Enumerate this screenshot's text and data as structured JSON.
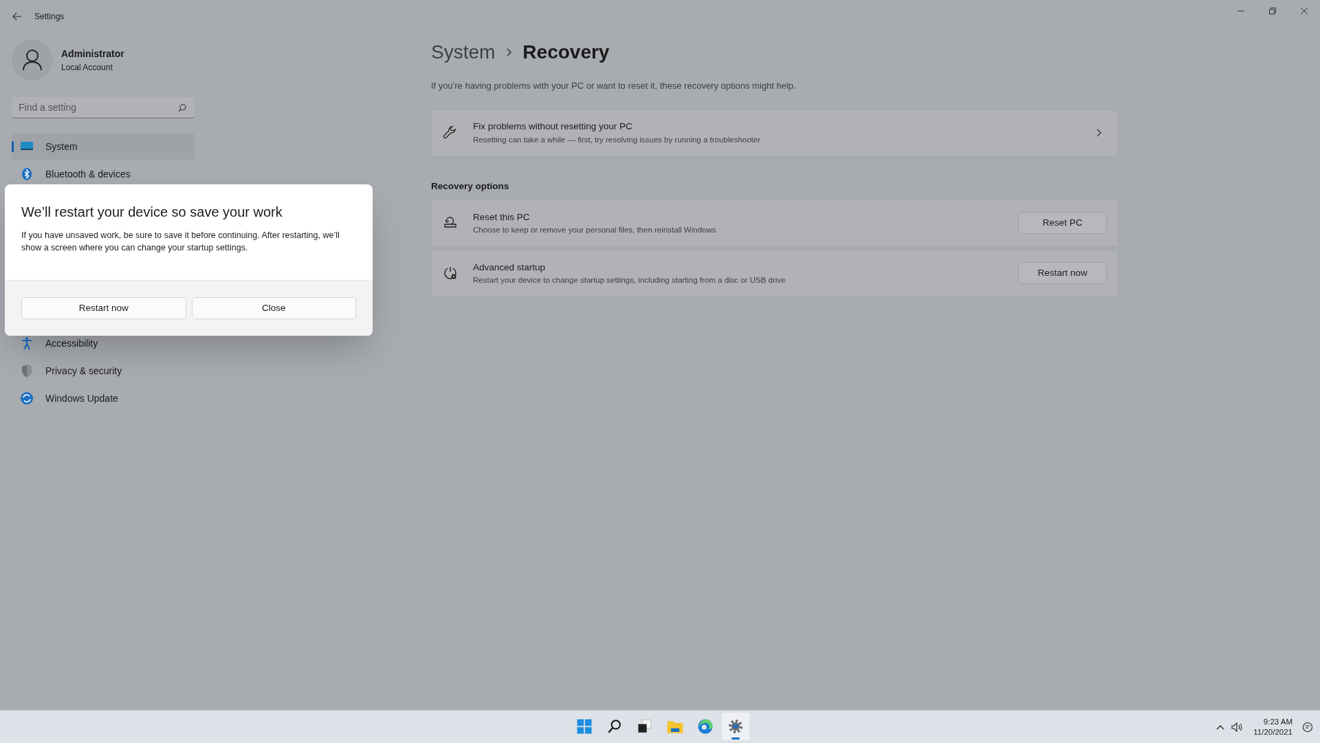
{
  "window": {
    "title": "Settings"
  },
  "account": {
    "name": "Administrator",
    "type": "Local Account"
  },
  "search": {
    "placeholder": "Find a setting"
  },
  "sidebar": {
    "items_top": [
      {
        "kind": "system",
        "label": "System",
        "selected": true
      },
      {
        "kind": "bluetooth",
        "label": "Bluetooth & devices",
        "selected": false
      }
    ],
    "items_bottom": [
      {
        "kind": "accessibility",
        "label": "Accessibility",
        "selected": false
      },
      {
        "kind": "privacy",
        "label": "Privacy & security",
        "selected": false
      },
      {
        "kind": "update",
        "label": "Windows Update",
        "selected": false
      }
    ]
  },
  "breadcrumb": {
    "parent": "System",
    "current": "Recovery"
  },
  "description": "If you're having problems with your PC or want to reset it, these recovery options might help.",
  "troubleshoot": {
    "title": "Fix problems without resetting your PC",
    "subtitle": "Resetting can take a while — first, try resolving issues by running a troubleshooter"
  },
  "section_heading": "Recovery options",
  "options": [
    {
      "kind": "reset",
      "title": "Reset this PC",
      "subtitle": "Choose to keep or remove your personal files, then reinstall Windows",
      "button": "Reset PC"
    },
    {
      "kind": "startup",
      "title": "Advanced startup",
      "subtitle": "Restart your device to change startup settings, including starting from a disc or USB drive",
      "button": "Restart now"
    }
  ],
  "dialog": {
    "title": "We’ll restart your device so save your work",
    "body": "If you have unsaved work, be sure to save it before continuing. After restarting, we’ll show a screen where you can change your startup settings.",
    "buttons": [
      "Restart now",
      "Close"
    ]
  },
  "taskbar": {
    "apps": [
      {
        "kind": "start",
        "selected": false
      },
      {
        "kind": "search",
        "selected": false
      },
      {
        "kind": "taskview",
        "selected": false
      },
      {
        "kind": "explorer",
        "selected": false
      },
      {
        "kind": "edge",
        "selected": false
      },
      {
        "kind": "settings",
        "selected": true
      }
    ]
  },
  "tray": {
    "time": "9:23 AM",
    "date": "11/20/2021"
  }
}
